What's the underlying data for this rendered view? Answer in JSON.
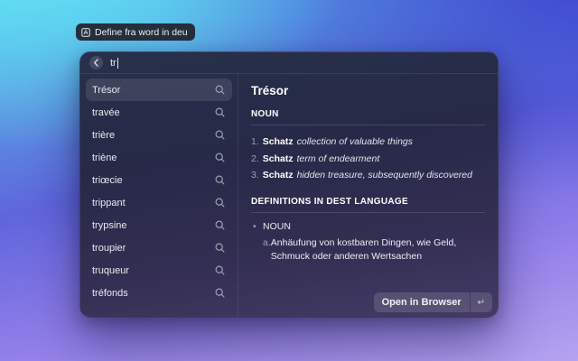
{
  "badge": {
    "label": "Define fra word in deu"
  },
  "search": {
    "value": "tr"
  },
  "list": {
    "selected_index": 0,
    "items": [
      "Trésor",
      "travée",
      "trière",
      "triène",
      "triœcie",
      "trippant",
      "trypsine",
      "troupier",
      "truqueur",
      "tréfonds"
    ]
  },
  "detail": {
    "title": "Trésor",
    "pos_heading": "NOUN",
    "definitions": [
      {
        "num": "1.",
        "term": "Schatz",
        "text": "collection of valuable things"
      },
      {
        "num": "2.",
        "term": "Schatz",
        "text": "term of endearment"
      },
      {
        "num": "3.",
        "term": "Schatz",
        "text": "hidden treasure, subsequently discovered"
      }
    ],
    "dest_heading": "DEFINITIONS IN DEST LANGUAGE",
    "dest_bullet": "•",
    "dest_pos": "NOUN",
    "dest_definitions": [
      {
        "marker": "a.",
        "text": "Anhäufung von kostbaren Dingen, wie Geld, Schmuck oder anderen Wertsachen"
      }
    ]
  },
  "actions": {
    "open_in_browser": "Open in Browser",
    "shortcut_key": "↵"
  },
  "colors": {
    "bg_top_left": "#5fe0f2",
    "bg_top_right": "#4349cf",
    "bg_bottom": "#b5a3f0",
    "window_top": "#27304a",
    "window_bottom": "#443b65",
    "selection": "rgba(255,255,255,0.10)"
  }
}
